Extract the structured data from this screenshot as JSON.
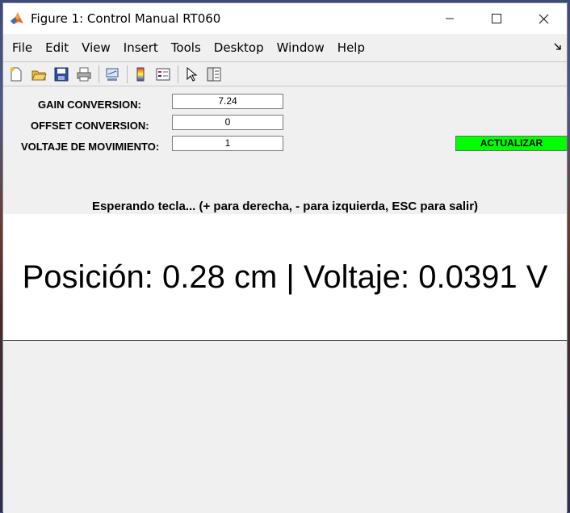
{
  "window": {
    "title": "Figure 1: Control Manual RT060"
  },
  "menu": [
    "File",
    "Edit",
    "View",
    "Insert",
    "Tools",
    "Desktop",
    "Window",
    "Help"
  ],
  "toolbar": [
    "new-figure-icon",
    "open-file-icon",
    "save-icon",
    "print-icon",
    "link-plot-icon",
    "colorbar-icon",
    "legend-icon",
    "pointer-icon",
    "property-inspector-icon"
  ],
  "controls": {
    "gain": {
      "label": "GAIN  CONVERSION:",
      "value": "7.24"
    },
    "offset": {
      "label": "OFFSET  CONVERSION:",
      "value": "0"
    },
    "voltage": {
      "label": "VOLTAJE DE MOVIMIENTO:",
      "value": "1"
    },
    "update_button": "ACTUALIZAR"
  },
  "status_text": "Esperando tecla... (+ para derecha, - para izquierda, ESC para salir)",
  "readout": "Posición: 0.28 cm | Voltaje: 0.0391 V",
  "colors": {
    "update_button": "#00ff00"
  }
}
